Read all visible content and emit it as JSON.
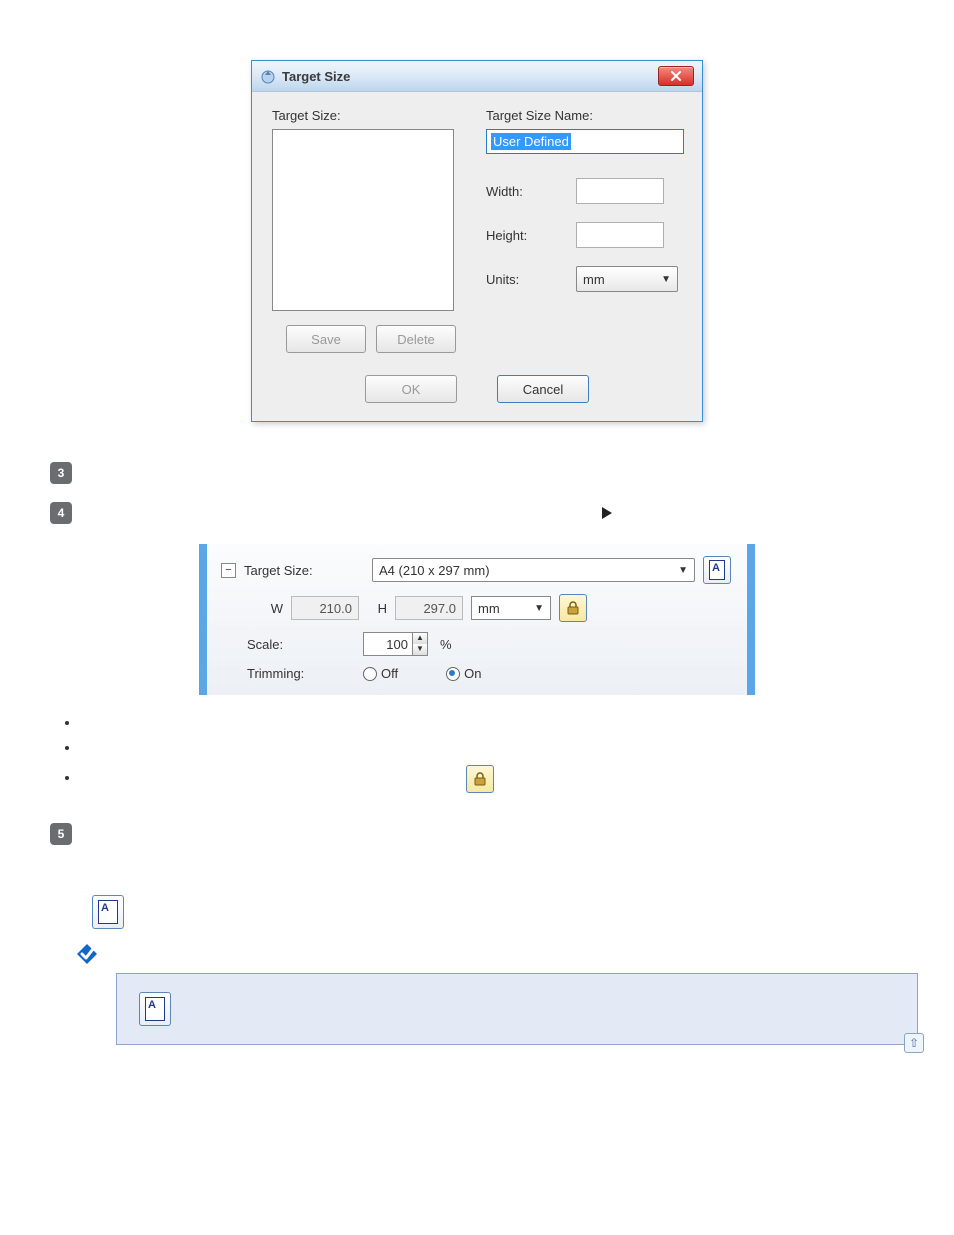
{
  "dialog": {
    "title": "Target Size",
    "target_size_label": "Target Size:",
    "target_size_name_label": "Target Size Name:",
    "name_value": "User Defined",
    "width_label": "Width:",
    "width_value": "",
    "height_label": "Height:",
    "height_value": "",
    "units_label": "Units:",
    "units_value": "mm",
    "save_btn": "Save",
    "delete_btn": "Delete",
    "ok_btn": "OK",
    "cancel_btn": "Cancel"
  },
  "steps": {
    "s3": "3",
    "s4": "4",
    "s5": "5"
  },
  "panel2": {
    "target_size_label": "Target Size:",
    "target_size_value": "A4 (210 x 297 mm)",
    "w_label": "W",
    "w_value": "210.0",
    "h_label": "H",
    "h_value": "297.0",
    "units_value": "mm",
    "scale_label": "Scale:",
    "scale_value": "100",
    "scale_unit": "%",
    "trimming_label": "Trimming:",
    "trim_off": "Off",
    "trim_on": "On"
  },
  "top_link": "⇧"
}
